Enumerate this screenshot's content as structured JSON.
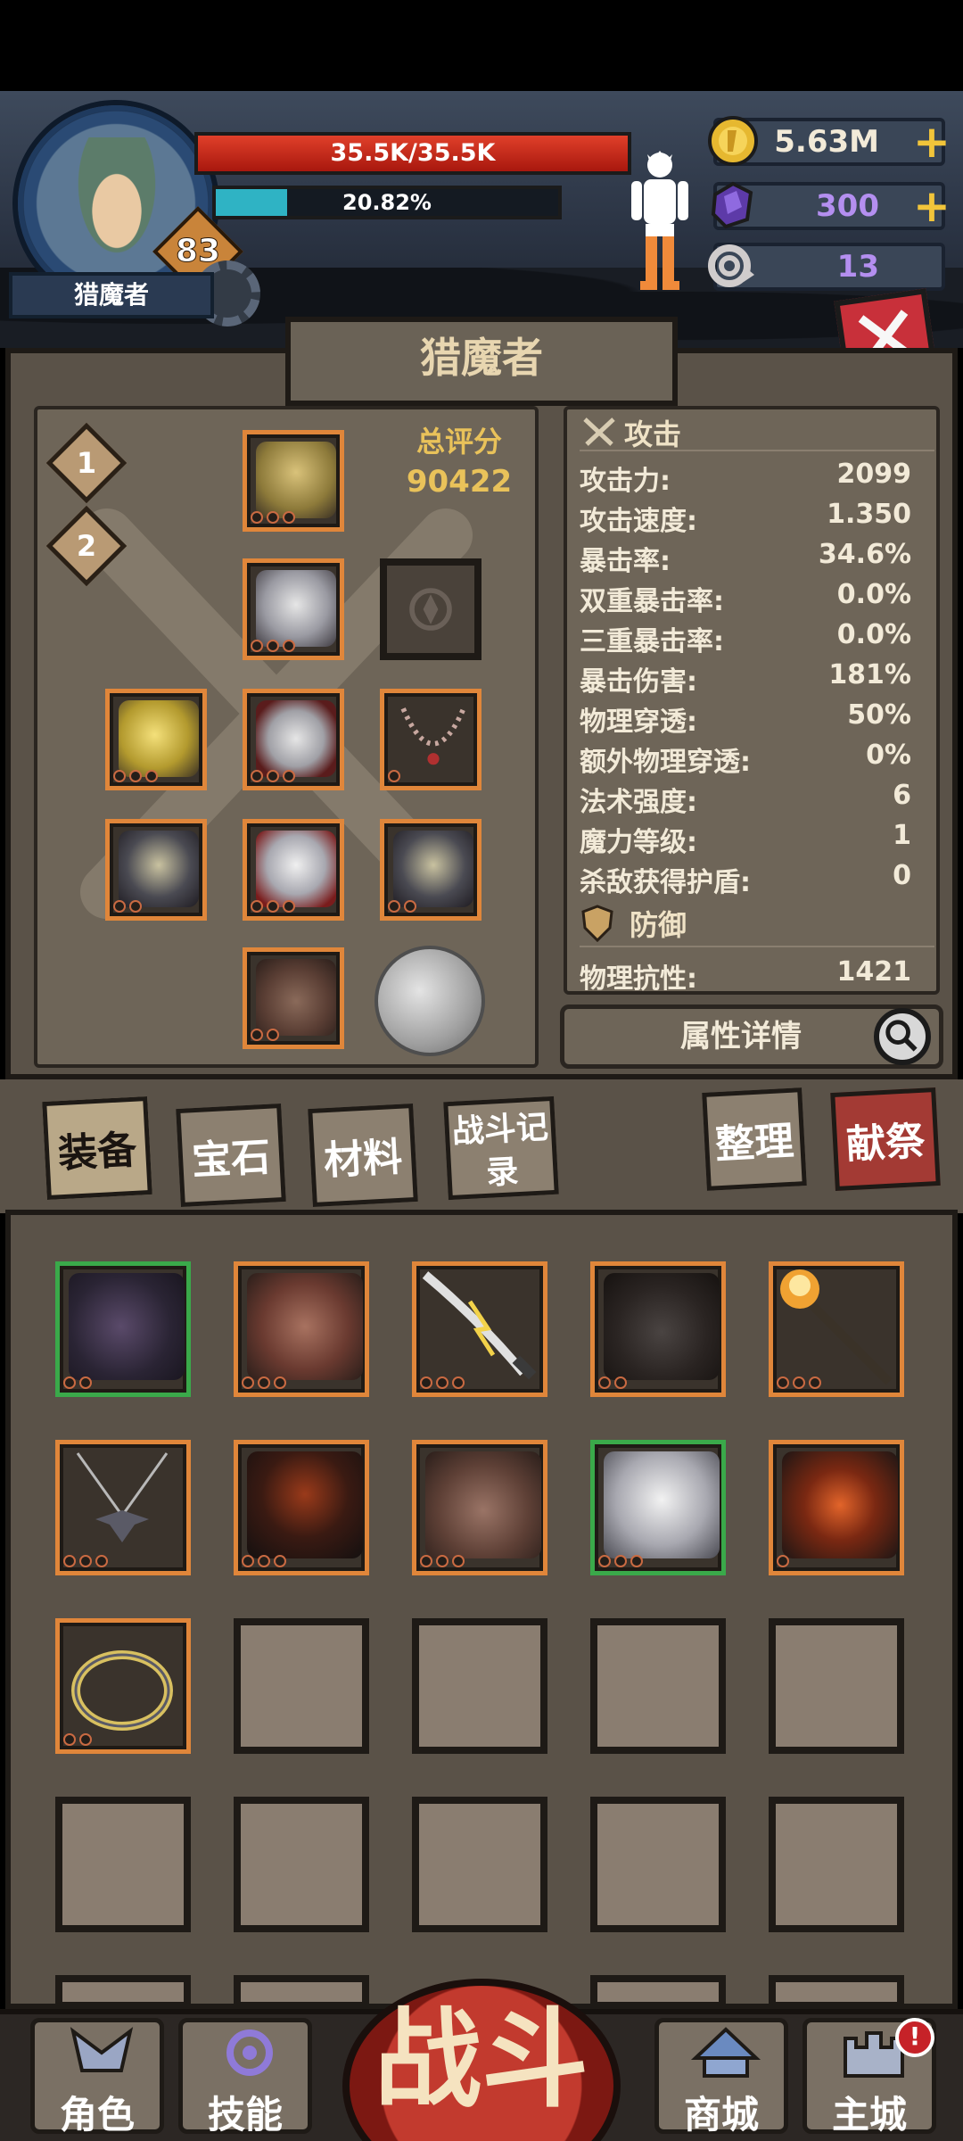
{
  "player": {
    "name": "猎魔者",
    "level": "83",
    "hp_text": "35.5K/35.5K",
    "hp_fraction": 1.0,
    "xp_text": "20.82%",
    "xp_fraction": 0.2082
  },
  "resources": {
    "gold": "5.63M",
    "crystal": "300",
    "horn": "13"
  },
  "panel": {
    "title": "猎魔者",
    "score_label": "总评分",
    "score_value": "90422",
    "loadouts": [
      "1",
      "2"
    ]
  },
  "stats": {
    "attack_header": "攻击",
    "attack_rows": [
      {
        "label": "攻击力:",
        "value": "2099"
      },
      {
        "label": "攻击速度:",
        "value": "1.350"
      },
      {
        "label": "暴击率:",
        "value": "34.6%"
      },
      {
        "label": "双重暴击率:",
        "value": "0.0%"
      },
      {
        "label": "三重暴击率:",
        "value": "0.0%"
      },
      {
        "label": "暴击伤害:",
        "value": "181%"
      },
      {
        "label": "物理穿透:",
        "value": "50%"
      },
      {
        "label": "额外物理穿透:",
        "value": "0%"
      },
      {
        "label": "法术强度:",
        "value": "6"
      },
      {
        "label": "魔力等级:",
        "value": "1"
      },
      {
        "label": "杀敌获得护盾:",
        "value": "0"
      }
    ],
    "defense_header": "防御",
    "defense_rows": [
      {
        "label": "物理抗性:",
        "value": "1421"
      }
    ],
    "detail_button": "属性详情"
  },
  "tabs": {
    "equipment": "装备",
    "gems": "宝石",
    "materials": "材料",
    "battle_log": "战斗记录",
    "sort": "整理",
    "sacrifice": "献祭"
  },
  "nav": {
    "character": "角色",
    "skills": "技能",
    "battle": "战斗",
    "shop": "商城",
    "city": "主城",
    "notice": "!"
  },
  "colors": {
    "rarity_orange": "#e0863a",
    "rarity_green": "#3aa94a",
    "hp_red": "#c0281a",
    "xp_cyan": "#2fb3c4",
    "score_gold": "#e9c25a"
  }
}
